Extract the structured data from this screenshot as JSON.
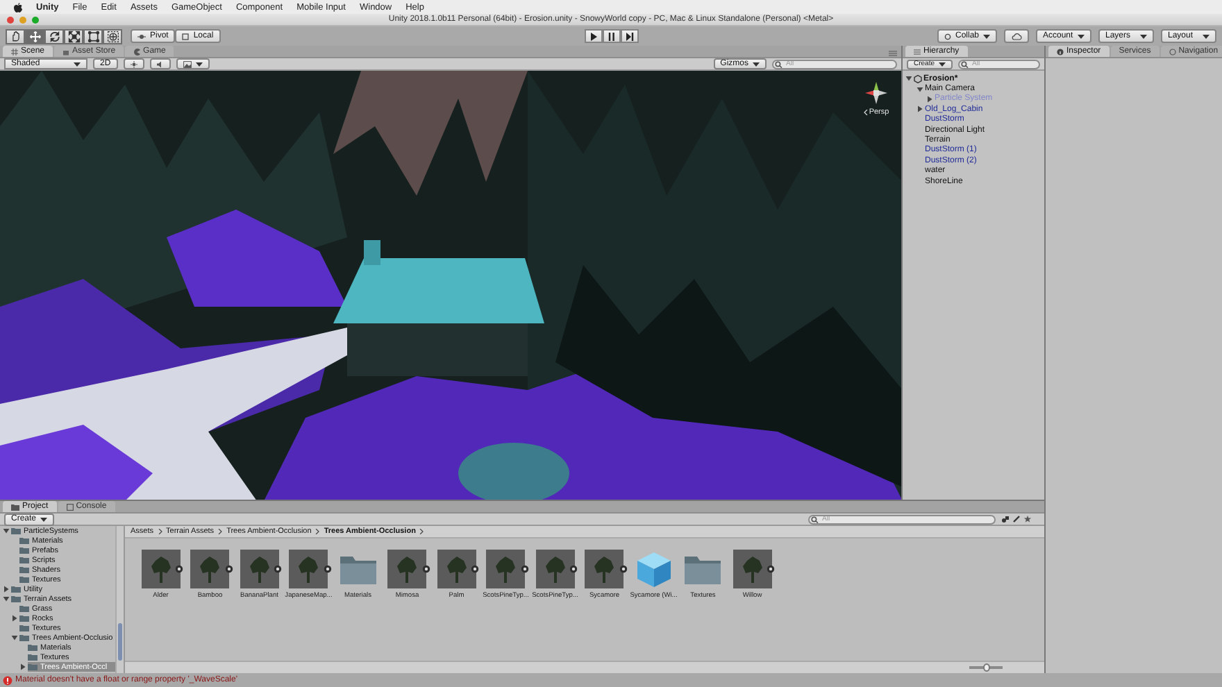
{
  "menu_bar": {
    "app": "Unity",
    "items": [
      "File",
      "Edit",
      "Assets",
      "GameObject",
      "Component",
      "Mobile Input",
      "Window",
      "Help"
    ]
  },
  "window": {
    "title": "Unity 2018.1.0b11 Personal (64bit) - Erosion.unity - SnowyWorld copy - PC, Mac & Linux Standalone (Personal) <Metal>"
  },
  "toolbar": {
    "tools": [
      {
        "kind": "hand",
        "selected": false
      },
      {
        "kind": "move",
        "selected": true
      },
      {
        "kind": "rotate",
        "selected": false
      },
      {
        "kind": "scale",
        "selected": false
      },
      {
        "kind": "rect",
        "selected": false
      },
      {
        "kind": "transform",
        "selected": false
      }
    ],
    "pivot": "Pivot",
    "space": "Local",
    "collab": "Collab",
    "account": "Account",
    "layers": "Layers",
    "layout": "Layout"
  },
  "scene_panel": {
    "tabs": [
      {
        "label": "Scene",
        "selected": true
      },
      {
        "label": "Asset Store",
        "selected": false
      },
      {
        "label": "Game",
        "selected": false
      }
    ],
    "shading": "Shaded",
    "mode_2d": "2D",
    "gizmos": "Gizmos",
    "search": {
      "placeholder": "All"
    },
    "view_label": "Persp"
  },
  "hierarchy": {
    "title": "Hierarchy",
    "create": "Create",
    "search": {
      "placeholder": "All"
    },
    "scene": {
      "label": "Erosion*",
      "expanded": true,
      "children": [
        {
          "label": "Main Camera",
          "prefab": false,
          "active": true,
          "expanded": true,
          "children": [
            {
              "label": "Particle System",
              "prefab": true,
              "active": false,
              "expanded": false
            }
          ]
        },
        {
          "label": "Old_Log_Cabin",
          "prefab": true,
          "active": true,
          "expanded": false
        },
        {
          "label": "DustStorm",
          "prefab": true,
          "active": true
        },
        {
          "label": "Directional Light",
          "prefab": false,
          "active": true
        },
        {
          "label": "Terrain",
          "prefab": false,
          "active": true
        },
        {
          "label": "DustStorm (1)",
          "prefab": true,
          "active": true
        },
        {
          "label": "DustStorm (2)",
          "prefab": true,
          "active": true
        },
        {
          "label": "water",
          "prefab": false,
          "active": true
        },
        {
          "label": "ShoreLine",
          "prefab": false,
          "active": true
        }
      ]
    }
  },
  "inspector": {
    "tabs": [
      {
        "label": "Inspector",
        "selected": true
      },
      {
        "label": "Services",
        "selected": false
      },
      {
        "label": "Navigation",
        "selected": false
      }
    ]
  },
  "project": {
    "tabs": [
      {
        "label": "Project",
        "selected": true
      },
      {
        "label": "Console",
        "selected": false
      }
    ],
    "create": "Create",
    "search": {
      "placeholder": "All"
    },
    "tree": [
      {
        "label": "ParticleSystems",
        "selected": false,
        "expanded": true,
        "children": [
          {
            "label": "Materials",
            "selected": false
          },
          {
            "label": "Prefabs",
            "selected": false
          },
          {
            "label": "Scripts",
            "selected": false
          },
          {
            "label": "Shaders",
            "selected": false
          },
          {
            "label": "Textures",
            "selected": false
          }
        ]
      },
      {
        "label": "Utility",
        "selected": false,
        "expanded": false
      },
      {
        "label": "Terrain Assets",
        "selected": false,
        "expanded": true,
        "children": [
          {
            "label": "Grass",
            "selected": false
          },
          {
            "label": "Rocks",
            "selected": false,
            "expanded": false
          },
          {
            "label": "Textures",
            "selected": false
          },
          {
            "label": "Trees Ambient-Occlusio",
            "selected": false,
            "expanded": true,
            "children": [
              {
                "label": "Materials",
                "selected": false
              },
              {
                "label": "Textures",
                "selected": false
              },
              {
                "label": "Trees Ambient-Occl",
                "selected": true,
                "expanded": false
              }
            ]
          }
        ]
      }
    ],
    "breadcrumb": [
      "Assets",
      "Terrain Assets",
      "Trees Ambient-Occlusion",
      "Trees Ambient-Occlusion"
    ],
    "assets": [
      {
        "label": "Alder",
        "kind": "tree",
        "prefab": true
      },
      {
        "label": "Bamboo",
        "kind": "tree",
        "prefab": true
      },
      {
        "label": "BananaPlant",
        "kind": "tree",
        "prefab": true
      },
      {
        "label": "JapaneseMap...",
        "kind": "tree",
        "prefab": true
      },
      {
        "label": "Materials",
        "kind": "folder",
        "prefab": false
      },
      {
        "label": "Mimosa",
        "kind": "tree",
        "prefab": true
      },
      {
        "label": "Palm",
        "kind": "tree",
        "prefab": true
      },
      {
        "label": "ScotsPineTyp...",
        "kind": "tree",
        "prefab": true
      },
      {
        "label": "ScotsPineTyp...",
        "kind": "tree",
        "prefab": true
      },
      {
        "label": "Sycamore",
        "kind": "tree",
        "prefab": true
      },
      {
        "label": "Sycamore (Wi...",
        "kind": "cube",
        "prefab": false
      },
      {
        "label": "Textures",
        "kind": "folder",
        "prefab": false
      },
      {
        "label": "Willow",
        "kind": "tree",
        "prefab": true
      }
    ],
    "icon_size": {
      "level": 0.5
    }
  },
  "status_bar": {
    "kind": "error",
    "message": "Material doesn't have a float or range property '_WaveScale'"
  }
}
